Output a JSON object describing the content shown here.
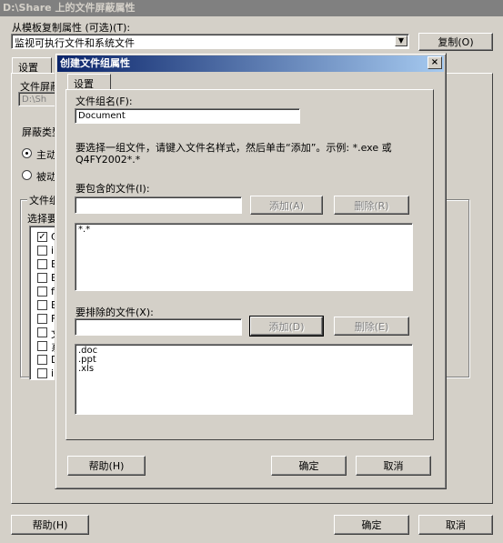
{
  "main": {
    "title": "D:\\Share 上的文件屏蔽属性",
    "template_label": "从模板复制属性 (可选)(T):",
    "template_value": "监视可执行文件和系统文件",
    "copy_button": "复制(O)",
    "tab_settings": "设置",
    "path_label": "文件屏蔽",
    "path_value": "D:\\Sh",
    "screen_type_label": "屏蔽类型",
    "radio_active": "主动",
    "radio_passive": "被动",
    "file_groups_label": "文件组",
    "select_label": "选择要",
    "group_chars": [
      "C",
      "i",
      "E",
      "E",
      "f",
      "B",
      "F",
      "文",
      "系",
      "D",
      "i"
    ],
    "help_button": "帮助(H)",
    "ok_button": "确定",
    "cancel_button": "取消"
  },
  "dialog": {
    "title": "创建文件组属性",
    "close_glyph": "×",
    "tab_settings": "设置",
    "group_name_label": "文件组名(F):",
    "group_name_value": "Document",
    "instructions": "要选择一组文件，请键入文件名样式，然后单击“添加”。示例: *.exe 或 Q4FY2002*.*",
    "include_label": "要包含的文件(I):",
    "include_input": "",
    "include_add": "添加(A)",
    "include_remove": "删除(R)",
    "include_items": [
      "*.*"
    ],
    "exclude_label": "要排除的文件(X):",
    "exclude_input": "",
    "exclude_add": "添加(D)",
    "exclude_remove": "删除(E)",
    "exclude_items": [
      ".doc",
      ".ppt",
      ".xls"
    ],
    "help_button": "帮助(H)",
    "ok_button": "确定",
    "cancel_button": "取消"
  }
}
